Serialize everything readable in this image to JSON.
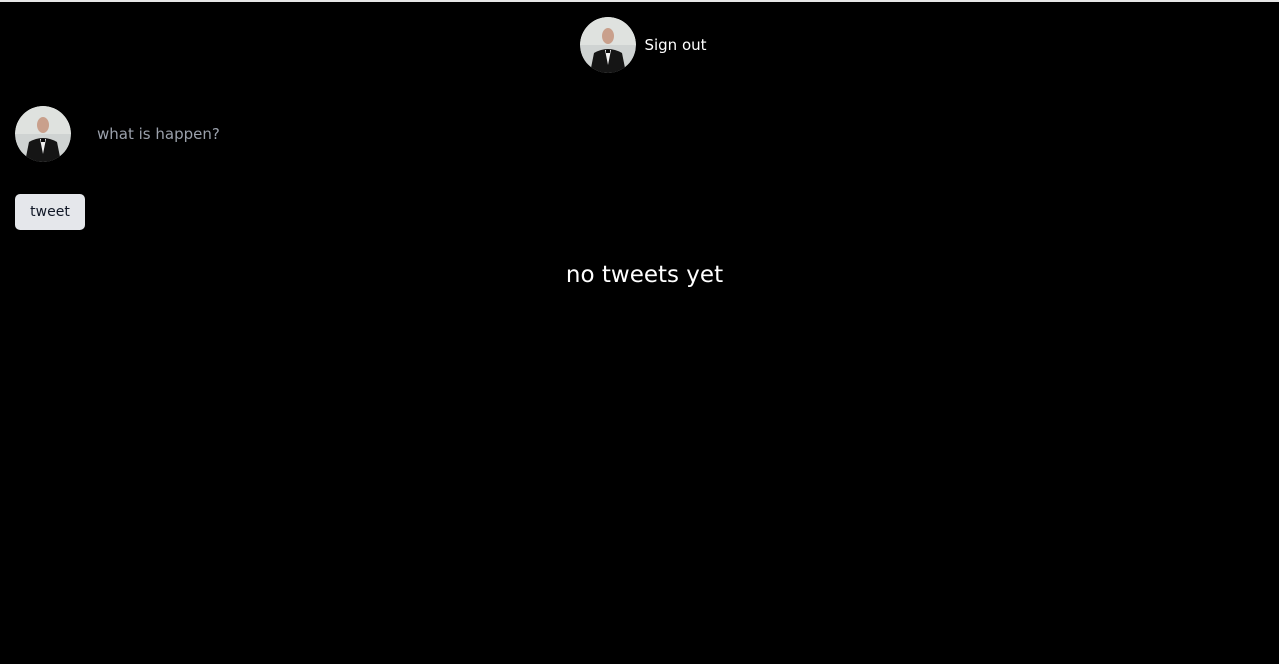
{
  "header": {
    "avatar_icon": "user-avatar-icon",
    "signout_label": "Sign out"
  },
  "compose": {
    "avatar_icon": "user-avatar-icon",
    "placeholder": "what is happen?",
    "value": ""
  },
  "actions": {
    "tweet_label": "tweet"
  },
  "feed": {
    "empty_message": "no tweets yet"
  },
  "colors": {
    "background": "#000000",
    "text": "#ffffff",
    "placeholder": "#9aa0ab",
    "button_bg": "#e5e7eb",
    "button_text": "#111827"
  }
}
